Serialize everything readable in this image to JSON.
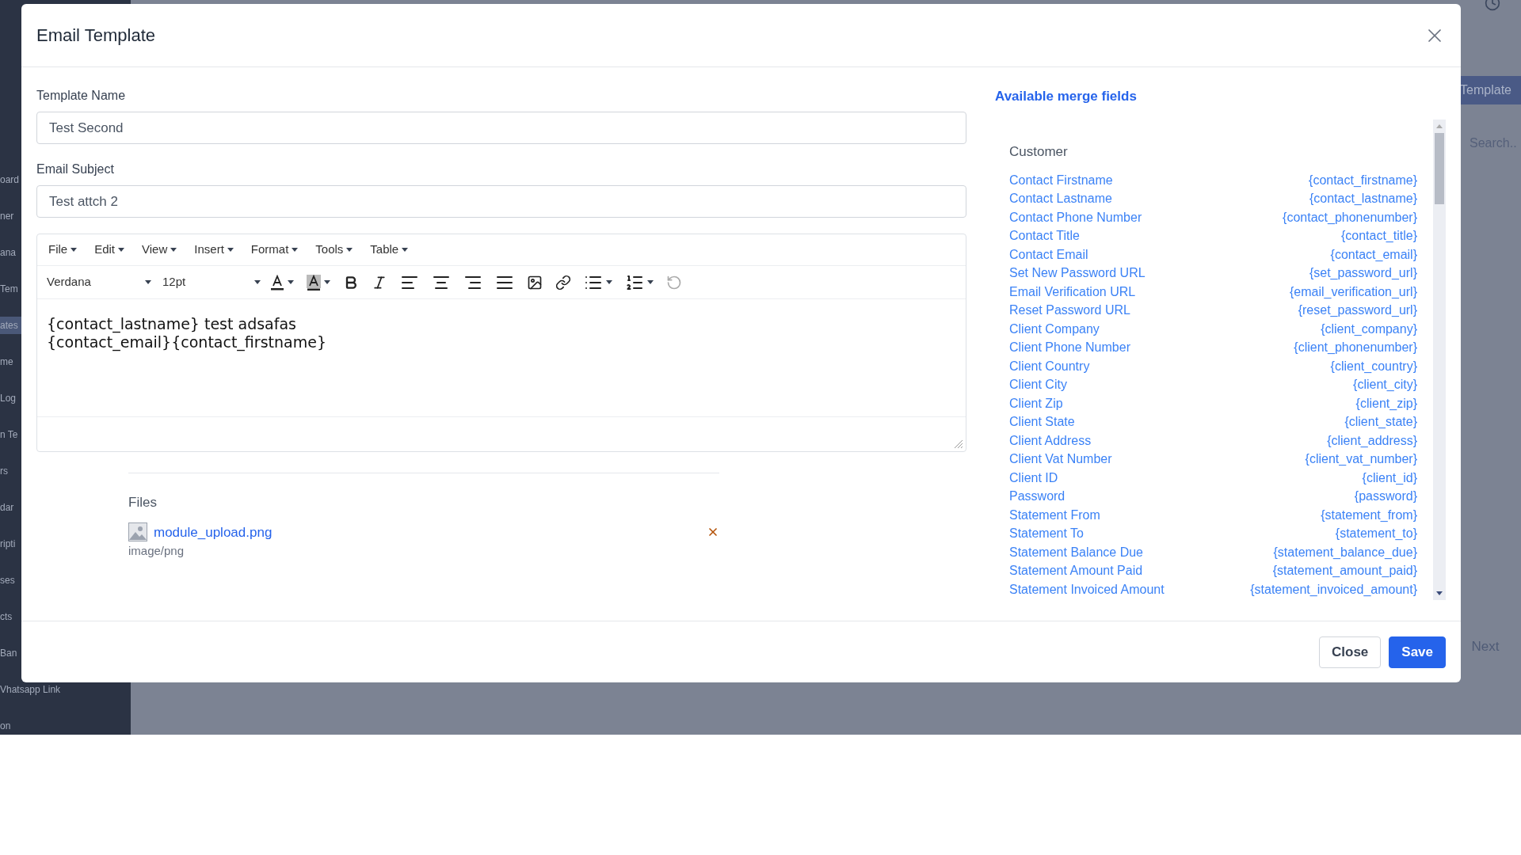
{
  "background": {
    "sidebar_items": [
      {
        "label": "oard",
        "selected": false
      },
      {
        "label": "ner",
        "selected": false
      },
      {
        "label": "ana",
        "selected": false
      },
      {
        "label": "Tem",
        "selected": false
      },
      {
        "label": "ates",
        "selected": true
      },
      {
        "label": "me",
        "selected": false
      },
      {
        "label": "Log",
        "selected": false
      },
      {
        "label": "n Te",
        "selected": false
      },
      {
        "label": "rs",
        "selected": false
      },
      {
        "label": "dar",
        "selected": false
      },
      {
        "label": "ripti",
        "selected": false
      },
      {
        "label": "ses",
        "selected": false
      },
      {
        "label": "cts",
        "selected": false
      },
      {
        "label": "Ban",
        "selected": false
      },
      {
        "label": "Vhatsapp Link",
        "selected": false
      },
      {
        "label": "on",
        "selected": false
      }
    ],
    "template_button": "Template",
    "search": {
      "placeholder": "Search.."
    },
    "next_button": "Next"
  },
  "modal": {
    "title": "Email Template",
    "fields": [
      {
        "label": "Template Name",
        "value": "Test Second"
      },
      {
        "label": "Email Subject",
        "value": "Test attch 2"
      }
    ],
    "editor": {
      "menus": [
        "File",
        "Edit",
        "View",
        "Insert",
        "Format",
        "Tools",
        "Table"
      ],
      "font": "Verdana",
      "size": "12pt",
      "content": [
        "{contact_lastname} test adsafas",
        "{contact_email}{contact_firstname}"
      ]
    },
    "files": {
      "heading": "Files",
      "items": [
        {
          "name": "module_upload.png",
          "type": "image/png"
        }
      ]
    },
    "merge": {
      "title": "Available merge fields",
      "group": "Customer",
      "fields": [
        {
          "label": "Contact Firstname",
          "tag": "{contact_firstname}"
        },
        {
          "label": "Contact Lastname",
          "tag": "{contact_lastname}"
        },
        {
          "label": "Contact Phone Number",
          "tag": "{contact_phonenumber}"
        },
        {
          "label": "Contact Title",
          "tag": "{contact_title}"
        },
        {
          "label": "Contact Email",
          "tag": "{contact_email}"
        },
        {
          "label": "Set New Password URL",
          "tag": "{set_password_url}"
        },
        {
          "label": "Email Verification URL",
          "tag": "{email_verification_url}"
        },
        {
          "label": "Reset Password URL",
          "tag": "{reset_password_url}"
        },
        {
          "label": "Client Company",
          "tag": "{client_company}"
        },
        {
          "label": "Client Phone Number",
          "tag": "{client_phonenumber}"
        },
        {
          "label": "Client Country",
          "tag": "{client_country}"
        },
        {
          "label": "Client City",
          "tag": "{client_city}"
        },
        {
          "label": "Client Zip",
          "tag": "{client_zip}"
        },
        {
          "label": "Client State",
          "tag": "{client_state}"
        },
        {
          "label": "Client Address",
          "tag": "{client_address}"
        },
        {
          "label": "Client Vat Number",
          "tag": "{client_vat_number}"
        },
        {
          "label": "Client ID",
          "tag": "{client_id}"
        },
        {
          "label": "Password",
          "tag": "{password}"
        },
        {
          "label": "Statement From",
          "tag": "{statement_from}"
        },
        {
          "label": "Statement To",
          "tag": "{statement_to}"
        },
        {
          "label": "Statement Balance Due",
          "tag": "{statement_balance_due}"
        },
        {
          "label": "Statement Amount Paid",
          "tag": "{statement_amount_paid}"
        },
        {
          "label": "Statement Invoiced Amount",
          "tag": "{statement_invoiced_amount}"
        }
      ]
    },
    "buttons": [
      {
        "label": "Close",
        "kind": "secondary"
      },
      {
        "label": "Save",
        "kind": "primary"
      }
    ]
  }
}
